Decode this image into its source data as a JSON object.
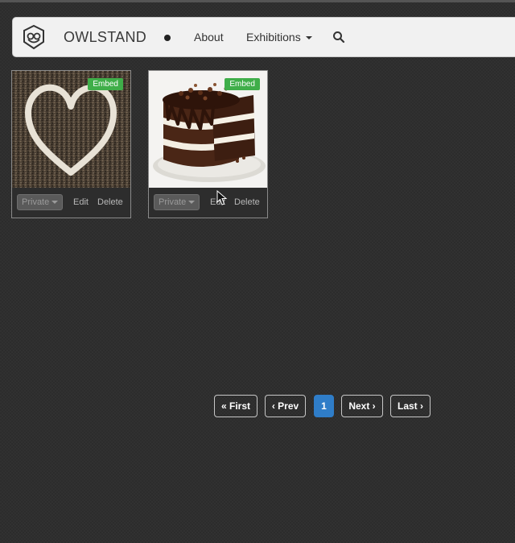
{
  "navbar": {
    "brand": "OWLSTAND",
    "links": [
      {
        "label": "About"
      },
      {
        "label": "Exhibitions"
      }
    ]
  },
  "cards": [
    {
      "badge": "Embed",
      "privacy": "Private",
      "edit": "Edit",
      "delete": "Delete",
      "image": "heart-of-seeds"
    },
    {
      "badge": "Embed",
      "privacy": "Private",
      "edit": "Edit",
      "delete": "Delete",
      "image": "chocolate-layer-cake"
    }
  ],
  "pagination": {
    "first": "« First",
    "prev": "‹ Prev",
    "current": "1",
    "next": "Next ›",
    "last": "Last ›"
  },
  "colors": {
    "background": "#2c2c2c",
    "navbar": "#f1f1f1",
    "embed_badge": "#3fae49",
    "active_page": "#2f7dc8"
  }
}
